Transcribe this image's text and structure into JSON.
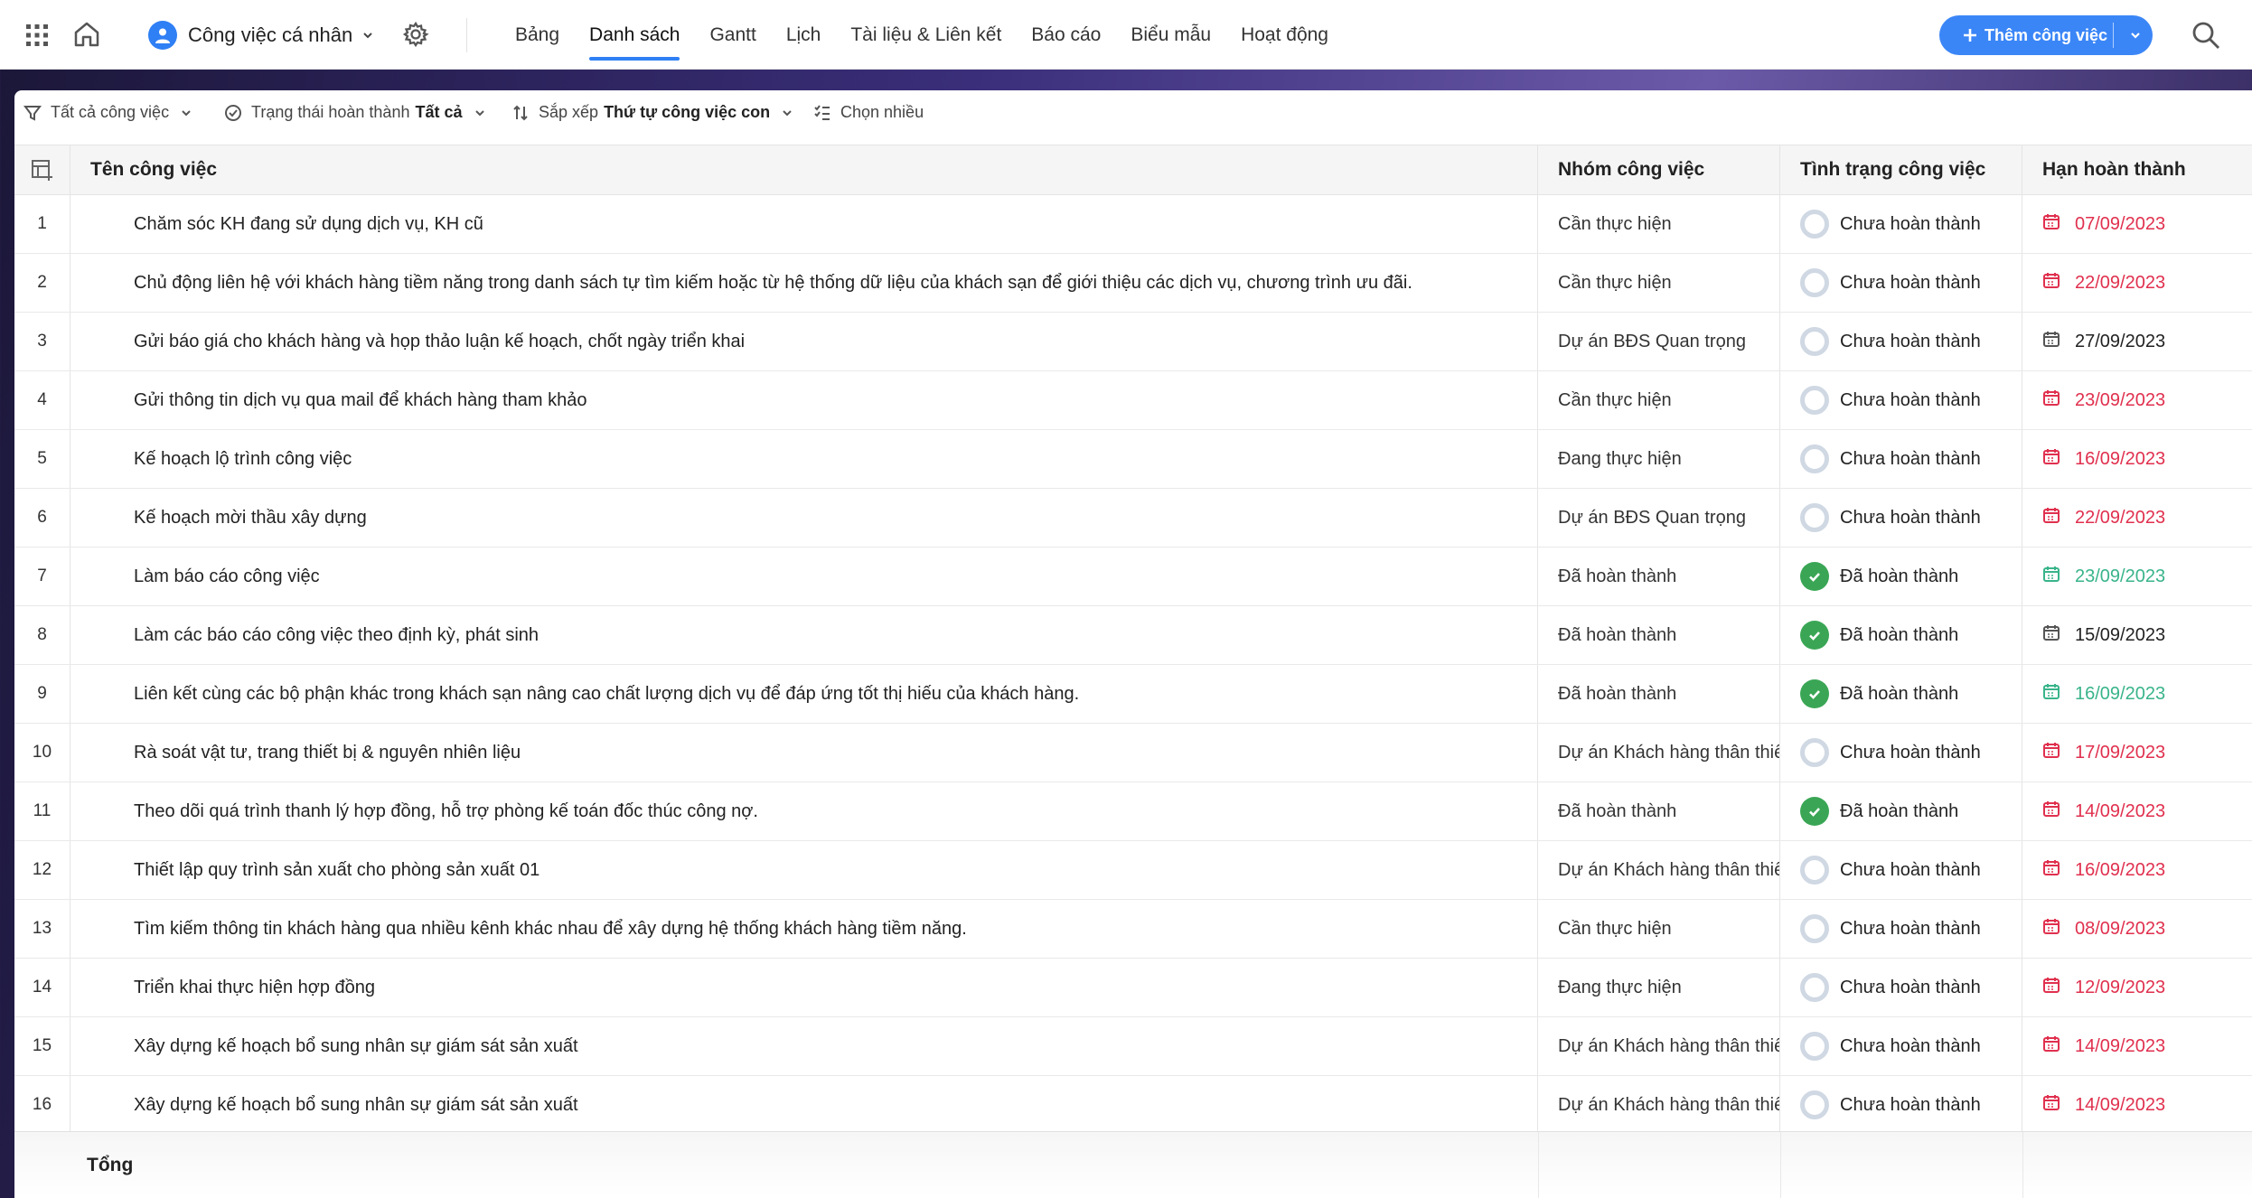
{
  "topbar": {
    "workspace_name": "Công việc cá nhân",
    "tabs": [
      "Bảng",
      "Danh sách",
      "Gantt",
      "Lịch",
      "Tài liệu & Liên kết",
      "Báo cáo",
      "Biểu mẫu",
      "Hoạt động"
    ],
    "active_tab": "Danh sách",
    "add_button_label": "Thêm công việc",
    "accent_color": "#3b86f7"
  },
  "toolbar": {
    "filter_label": "Tất cả công việc",
    "completion_label": "Trạng thái hoàn thành",
    "completion_value": "Tất cả",
    "sort_label": "Sắp xếp",
    "sort_value": "Thứ tự công việc con",
    "multi_select_label": "Chọn nhiều"
  },
  "table": {
    "headers": {
      "name": "Tên công việc",
      "group": "Nhóm công việc",
      "status": "Tình trạng công việc",
      "due": "Hạn hoàn thành"
    },
    "rows": [
      {
        "num": "1",
        "name": "Chăm sóc KH đang sử dụng dịch vụ, KH cũ",
        "group": "Cần thực hiện",
        "status": "Chưa hoàn thành",
        "done": false,
        "due": "07/09/2023",
        "due_state": "overdue"
      },
      {
        "num": "2",
        "name": "Chủ động liên hệ với khách hàng tiềm năng trong danh sách tự tìm kiếm hoặc từ hệ thống dữ liệu của khách sạn để giới thiệu các dịch vụ, chương trình ưu đãi.",
        "group": "Cần thực hiện",
        "status": "Chưa hoàn thành",
        "done": false,
        "due": "22/09/2023",
        "due_state": "overdue"
      },
      {
        "num": "3",
        "name": "Gửi báo giá cho khách hàng và họp thảo luận kế hoạch, chốt ngày triển khai",
        "group": "Dự án BĐS Quan trọng",
        "status": "Chưa hoàn thành",
        "done": false,
        "due": "27/09/2023",
        "due_state": "normal"
      },
      {
        "num": "4",
        "name": "Gửi thông tin dịch vụ qua mail để khách hàng tham khảo",
        "group": "Cần thực hiện",
        "status": "Chưa hoàn thành",
        "done": false,
        "due": "23/09/2023",
        "due_state": "overdue"
      },
      {
        "num": "5",
        "name": "Kế hoạch lộ trình công việc",
        "group": "Đang thực hiện",
        "status": "Chưa hoàn thành",
        "done": false,
        "due": "16/09/2023",
        "due_state": "overdue"
      },
      {
        "num": "6",
        "name": "Kế hoạch mời thầu xây dựng",
        "group": "Dự án BĐS Quan trọng",
        "status": "Chưa hoàn thành",
        "done": false,
        "due": "22/09/2023",
        "due_state": "overdue"
      },
      {
        "num": "7",
        "name": "Làm báo cáo công việc",
        "group": "Đã hoàn thành",
        "status": "Đã hoàn thành",
        "done": true,
        "due": "23/09/2023",
        "due_state": "done"
      },
      {
        "num": "8",
        "name": "Làm các báo cáo công việc theo định kỳ, phát sinh",
        "group": "Đã hoàn thành",
        "status": "Đã hoàn thành",
        "done": true,
        "due": "15/09/2023",
        "due_state": "normal"
      },
      {
        "num": "9",
        "name": "Liên kết cùng các bộ phận khác trong khách sạn nâng cao chất lượng dịch vụ để đáp ứng tốt thị hiếu của khách hàng.",
        "group": "Đã hoàn thành",
        "status": "Đã hoàn thành",
        "done": true,
        "due": "16/09/2023",
        "due_state": "done"
      },
      {
        "num": "10",
        "name": "Rà soát vật tư, trang thiết bị & nguyên nhiên liệu",
        "group": "Dự án Khách hàng thân thiết",
        "status": "Chưa hoàn thành",
        "done": false,
        "due": "17/09/2023",
        "due_state": "overdue"
      },
      {
        "num": "11",
        "name": "Theo dõi quá trình thanh lý hợp đồng, hỗ trợ phòng kế toán đốc thúc công nợ.",
        "group": "Đã hoàn thành",
        "status": "Đã hoàn thành",
        "done": true,
        "due": "14/09/2023",
        "due_state": "overdue"
      },
      {
        "num": "12",
        "name": "Thiết lập quy trình sản xuất cho phòng sản xuất 01",
        "group": "Dự án Khách hàng thân thiết",
        "status": "Chưa hoàn thành",
        "done": false,
        "due": "16/09/2023",
        "due_state": "overdue"
      },
      {
        "num": "13",
        "name": "Tìm kiếm thông tin khách hàng qua nhiều kênh khác nhau để xây dựng hệ thống khách hàng tiềm năng.",
        "group": "Cần thực hiện",
        "status": "Chưa hoàn thành",
        "done": false,
        "due": "08/09/2023",
        "due_state": "overdue"
      },
      {
        "num": "14",
        "name": "Triển khai thực hiện hợp đồng",
        "group": "Đang thực hiện",
        "status": "Chưa hoàn thành",
        "done": false,
        "due": "12/09/2023",
        "due_state": "overdue"
      },
      {
        "num": "15",
        "name": "Xây dựng kế hoạch bổ sung nhân sự giám sát sản xuất",
        "group": "Dự án Khách hàng thân thiết",
        "status": "Chưa hoàn thành",
        "done": false,
        "due": "14/09/2023",
        "due_state": "overdue"
      },
      {
        "num": "16",
        "name": "Xây dựng kế hoạch bổ sung nhân sự giám sát sản xuất",
        "group": "Dự án Khách hàng thân thiết",
        "status": "Chưa hoàn thành",
        "done": false,
        "due": "14/09/2023",
        "due_state": "overdue"
      }
    ],
    "footer_label": "Tổng"
  },
  "colors": {
    "overdue": "#e0304e",
    "done_date": "#39b48a",
    "done_check": "#3aa655",
    "pending_ring": "#cfd8e3"
  }
}
